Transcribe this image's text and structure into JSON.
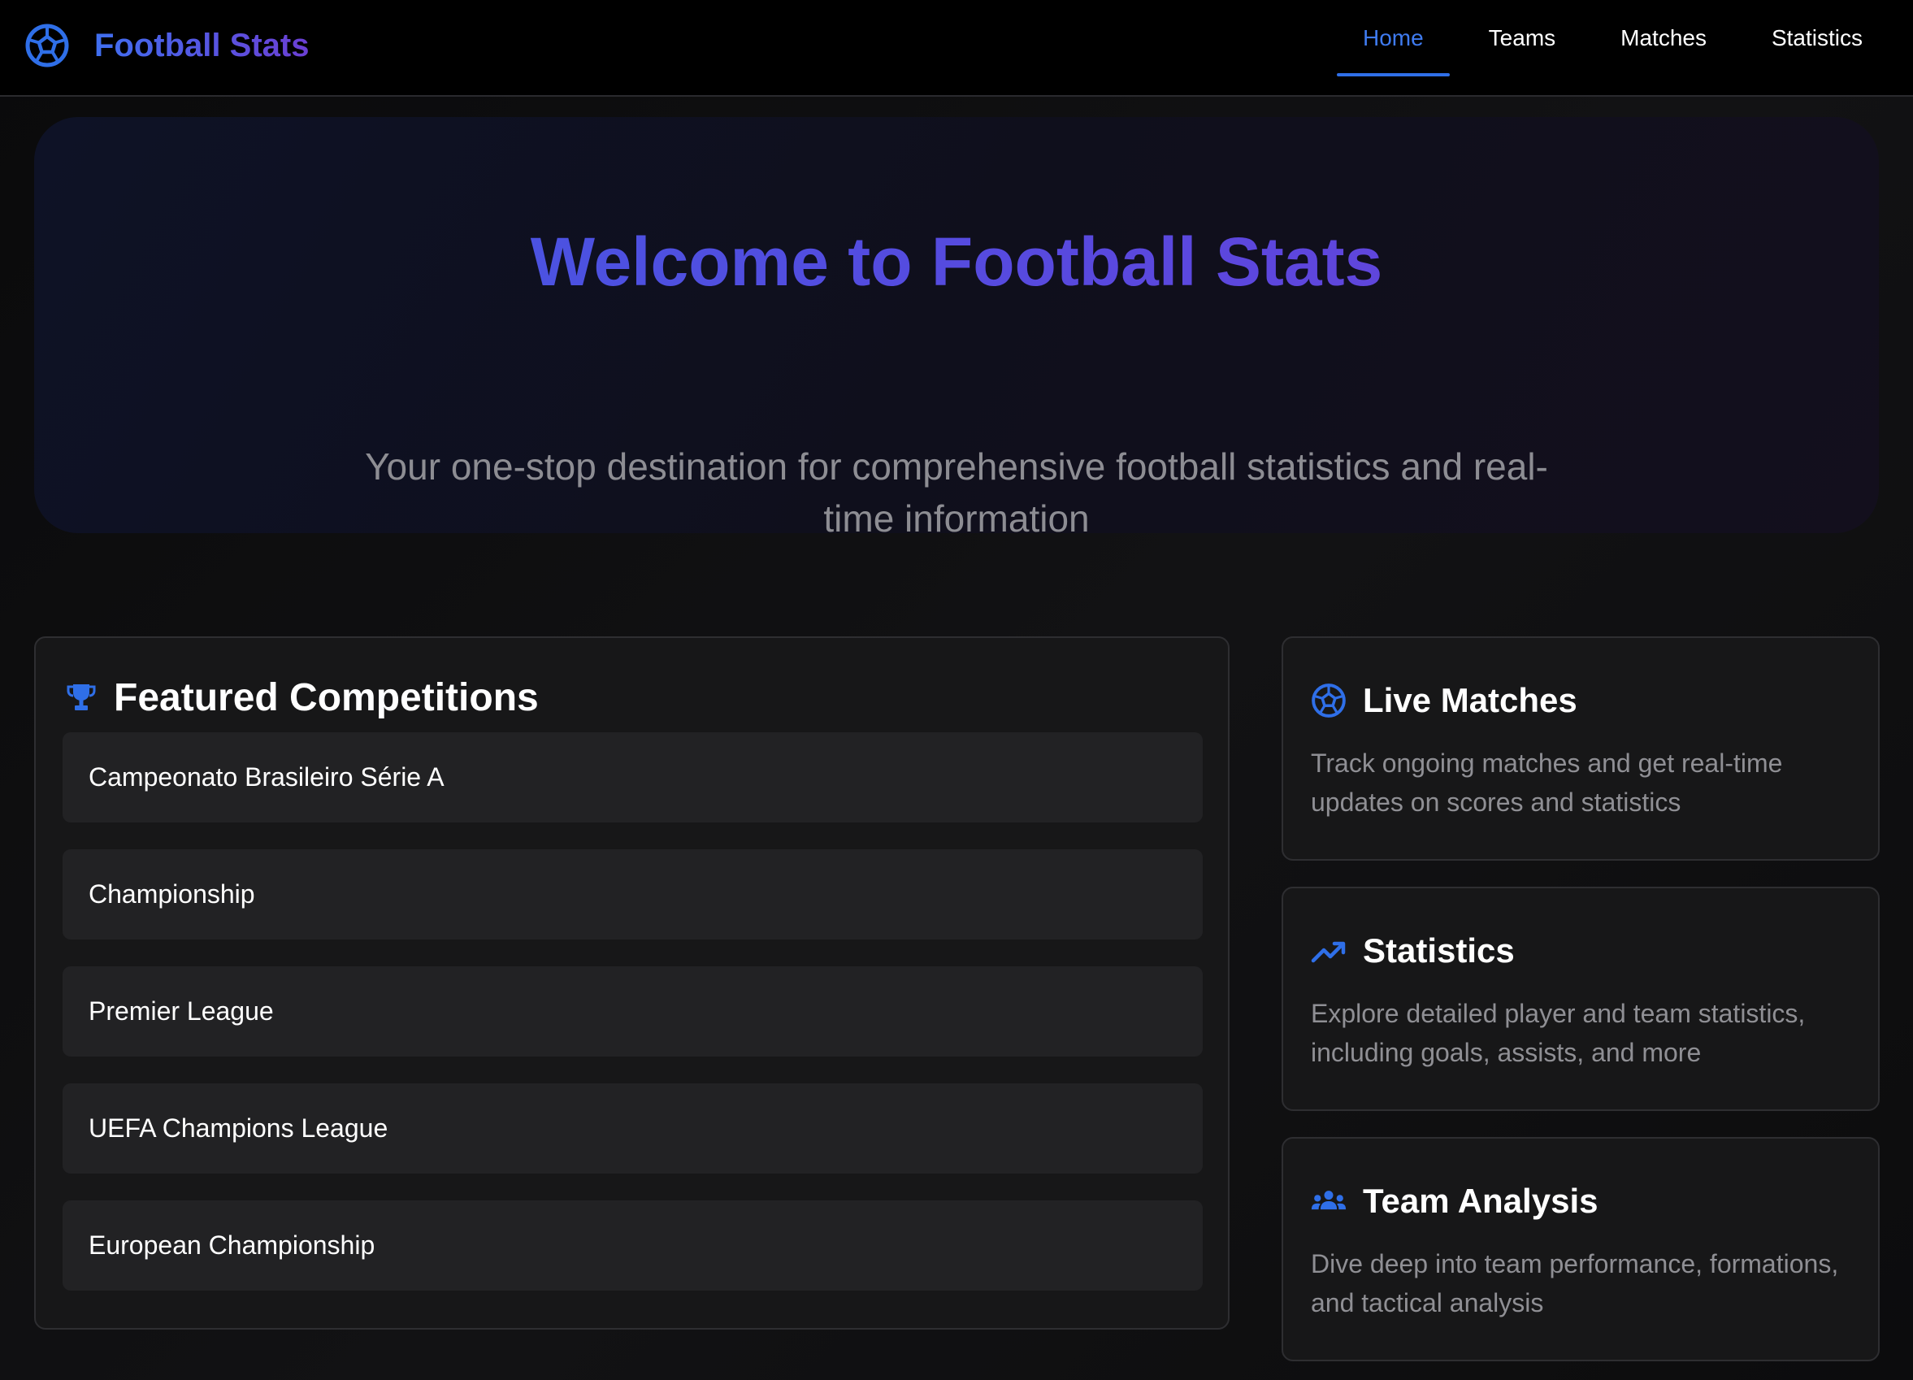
{
  "brand": {
    "name": "Football Stats",
    "icon": "soccer-ball-icon"
  },
  "nav": {
    "items": [
      {
        "label": "Home",
        "active": true
      },
      {
        "label": "Teams",
        "active": false
      },
      {
        "label": "Matches",
        "active": false
      },
      {
        "label": "Statistics",
        "active": false
      }
    ]
  },
  "hero": {
    "title": "Welcome to Football Stats",
    "subtitle": "Your one-stop destination for comprehensive football statistics and real-time information"
  },
  "competitions": {
    "icon": "trophy-icon",
    "title": "Featured Competitions",
    "items": [
      "Campeonato Brasileiro Série A",
      "Championship",
      "Premier League",
      "UEFA Champions League",
      "European Championship"
    ]
  },
  "features": [
    {
      "icon": "soccer-ball-icon",
      "title": "Live Matches",
      "description": "Track ongoing matches and get real-time updates on scores and statistics"
    },
    {
      "icon": "trending-up-icon",
      "title": "Statistics",
      "description": "Explore detailed player and team statistics, including goals, assists, and more"
    },
    {
      "icon": "team-icon",
      "title": "Team Analysis",
      "description": "Dive deep into team performance, formations, and tactical analysis"
    }
  ],
  "colors": {
    "accent": "#2f6fe8",
    "brand_gradient_start": "#3f6ff0",
    "brand_gradient_end": "#6b3fd4",
    "background": "#0b0b0c",
    "card": "#171718",
    "muted_text": "#8f8f94"
  }
}
